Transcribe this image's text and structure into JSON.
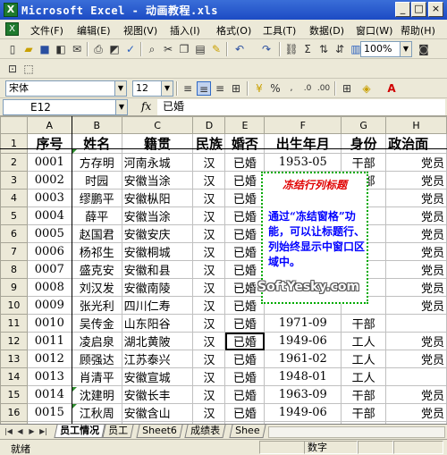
{
  "window": {
    "title": "Microsoft Excel - 动画教程.xls",
    "app_icon": "X",
    "min": "_",
    "max": "□",
    "close": "×"
  },
  "menu": {
    "doc_icon": "X",
    "items": [
      "文件(F)",
      "编辑(E)",
      "视图(V)",
      "插入(I)",
      "格式(O)",
      "工具(T)",
      "数据(D)",
      "窗口(W)",
      "帮助(H)"
    ]
  },
  "toolbar": {
    "zoom": "100%"
  },
  "format": {
    "font": "宋体",
    "size": "12"
  },
  "formula_bar": {
    "cell_ref": "E12",
    "fx": "fx",
    "value": "已婚"
  },
  "sheet": {
    "columns": [
      "A",
      "B",
      "C",
      "D",
      "E",
      "F",
      "G",
      "H"
    ],
    "rows": [
      {
        "n": "1",
        "cells": [
          "序号",
          "姓名",
          "籍贯",
          "民族",
          "婚否",
          "出生年月",
          "身份",
          "政治面"
        ]
      },
      {
        "n": "2",
        "cells": [
          "0001",
          "方存明",
          "河南永城",
          "汉",
          "已婚",
          "1953-05",
          "干部",
          "党员"
        ]
      },
      {
        "n": "3",
        "cells": [
          "0002",
          "时园",
          "安徽当涂",
          "汉",
          "已婚",
          "1947-10",
          "干部",
          "党员"
        ]
      },
      {
        "n": "4",
        "cells": [
          "0003",
          "缪鹏平",
          "安徽枞阳",
          "汉",
          "已婚",
          "",
          "",
          "党员"
        ]
      },
      {
        "n": "5",
        "cells": [
          "0004",
          "薛平",
          "安徽当涂",
          "汉",
          "已婚",
          "",
          "",
          "党员"
        ]
      },
      {
        "n": "6",
        "cells": [
          "0005",
          "赵国君",
          "安徽安庆",
          "汉",
          "已婚",
          "",
          "",
          "党员"
        ]
      },
      {
        "n": "7",
        "cells": [
          "0006",
          "杨祁生",
          "安徽桐城",
          "汉",
          "已婚",
          "",
          "",
          "党员"
        ]
      },
      {
        "n": "8",
        "cells": [
          "0007",
          "盛克安",
          "安徽和县",
          "汉",
          "已婚",
          "",
          "",
          "党员"
        ]
      },
      {
        "n": "9",
        "cells": [
          "0008",
          "刘汉发",
          "安徽南陵",
          "汉",
          "已婚",
          "",
          "",
          "党员"
        ]
      },
      {
        "n": "10",
        "cells": [
          "0009",
          "张光利",
          "四川仁寿",
          "汉",
          "已婚",
          "",
          "",
          "党员"
        ]
      },
      {
        "n": "11",
        "cells": [
          "0010",
          "吴传金",
          "山东阳谷",
          "汉",
          "已婚",
          "1971-09",
          "干部",
          ""
        ]
      },
      {
        "n": "12",
        "cells": [
          "0011",
          "凌启泉",
          "湖北黄陂",
          "汉",
          "已婚",
          "1949-06",
          "工人",
          "党员"
        ]
      },
      {
        "n": "13",
        "cells": [
          "0012",
          "顾强达",
          "江苏泰兴",
          "汉",
          "已婚",
          "1961-02",
          "工人",
          "党员"
        ]
      },
      {
        "n": "14",
        "cells": [
          "0013",
          "肖清平",
          "安徽宣城",
          "汉",
          "已婚",
          "1948-01",
          "工人",
          ""
        ]
      },
      {
        "n": "15",
        "cells": [
          "0014",
          "沈建明",
          "安徽长丰",
          "汉",
          "已婚",
          "1963-09",
          "干部",
          "党员"
        ]
      },
      {
        "n": "16",
        "cells": [
          "0015",
          "江秋周",
          "安徽含山",
          "汉",
          "已婚",
          "1949-06",
          "干部",
          "党员"
        ]
      },
      {
        "n": "17",
        "cells": [
          "0016",
          "张荣生",
          "安徽滁州",
          "汉",
          "已婚",
          "1946-01",
          "干部",
          "党员"
        ]
      }
    ]
  },
  "note": {
    "title": "冻结行列标题",
    "body": "通过“冻结窗格”功能，可以让标题行、列始终显示中窗口区域中。"
  },
  "watermark": "SoftYesky.com",
  "tabs": [
    "员工情况",
    "员工",
    "Sheet6",
    "成绩表",
    "Shee"
  ],
  "status": {
    "ready": "就绪",
    "num": "数字"
  },
  "colors": {
    "title_bar": "#1c4bc4",
    "note_border": "#00aa00",
    "note_title": "#e00000",
    "note_text": "#0000ff"
  }
}
